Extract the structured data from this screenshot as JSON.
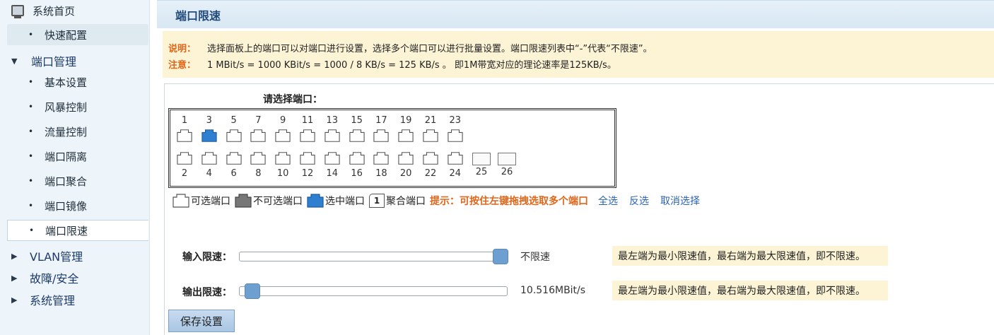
{
  "sidebar": {
    "home": "系统首页",
    "quick": "快速配置",
    "port_group": "端口管理",
    "items": [
      "基本设置",
      "风暴控制",
      "流量控制",
      "端口隔离",
      "端口聚合",
      "端口镜像",
      "端口限速"
    ],
    "active": "端口限速",
    "groups": [
      "VLAN管理",
      "故障/安全",
      "系统管理"
    ]
  },
  "title": "端口限速",
  "notice": {
    "k1": "说明：",
    "t1": "选择面板上的端口可以对端口进行设置，选择多个端口可以进行批量设置。端口限速列表中“-”代表“不限速”。",
    "k2": "注意：",
    "t2": "1 MBit/s = 1000 KBit/s = 1000 / 8 KB/s = 125 KB/s 。 即1M带宽对应的理论速率是125KB/s。"
  },
  "port_panel": {
    "title": "请选择端口：",
    "odd_ports": [
      "1",
      "3",
      "5",
      "7",
      "9",
      "11",
      "13",
      "15",
      "17",
      "19",
      "21",
      "23"
    ],
    "even_ports": [
      "2",
      "4",
      "6",
      "8",
      "10",
      "12",
      "14",
      "16",
      "18",
      "20",
      "22",
      "24"
    ],
    "sfp_ports": [
      "25",
      "26"
    ],
    "selected_ports": [
      "3"
    ]
  },
  "legend": {
    "selectable": "可选端口",
    "unselectable": "不可选端口",
    "selected": "选中端口",
    "agg_num": "1",
    "aggregated": "聚合端口",
    "hint": "提示：可按住左键拖拽选取多个端口",
    "select_all": "全选",
    "invert": "反选",
    "cancel": "取消选择"
  },
  "rate_limit": {
    "input_label": "输入限速：",
    "input_value": "不限速",
    "input_level": 1.0,
    "output_label": "输出限速：",
    "output_value": "10.516MBit/s",
    "output_level": 0.02,
    "tip": "最左端为最小限速值，最右端为最大限速值，即不限速。"
  },
  "save_label": "保存设置",
  "colors": {
    "selected_port": "#2f7fd0",
    "unselectable_port": "#777777",
    "thumb": "#6e9fd1",
    "hint": "#e0661a",
    "link": "#2b62b5"
  }
}
